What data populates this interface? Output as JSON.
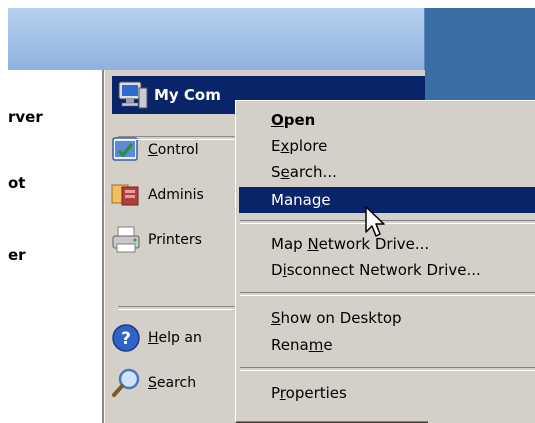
{
  "left_column": {
    "items": [
      {
        "text": "rver"
      },
      {
        "text": "ot"
      },
      {
        "text": "er"
      }
    ]
  },
  "start_menu": {
    "my_computer_label": "My Com",
    "items": [
      {
        "label": "Control",
        "mnemonic": "C",
        "icon": "control-panel-icon"
      },
      {
        "label": "Adminis",
        "icon": "administrative-tools-icon"
      },
      {
        "label": "Printers",
        "icon": "printers-icon"
      },
      {
        "label": "Help an",
        "mnemonic": "H",
        "icon": "help-icon"
      },
      {
        "label": "Search",
        "mnemonic": "S",
        "icon": "search-icon"
      }
    ]
  },
  "context_menu": {
    "items": [
      {
        "label": "Open",
        "bold": true
      },
      {
        "label": "Explore"
      },
      {
        "label": "Search..."
      },
      {
        "label": "Manage",
        "selected": true
      },
      {
        "label": "Map Network Drive..."
      },
      {
        "label": "Disconnect Network Drive..."
      },
      {
        "label": "Show on Desktop"
      },
      {
        "label": "Rename"
      },
      {
        "label": "Properties"
      }
    ]
  },
  "colors": {
    "highlight": "#0a246a",
    "menu_face": "#d4d0c8",
    "desktop": "#3a6ea5"
  }
}
